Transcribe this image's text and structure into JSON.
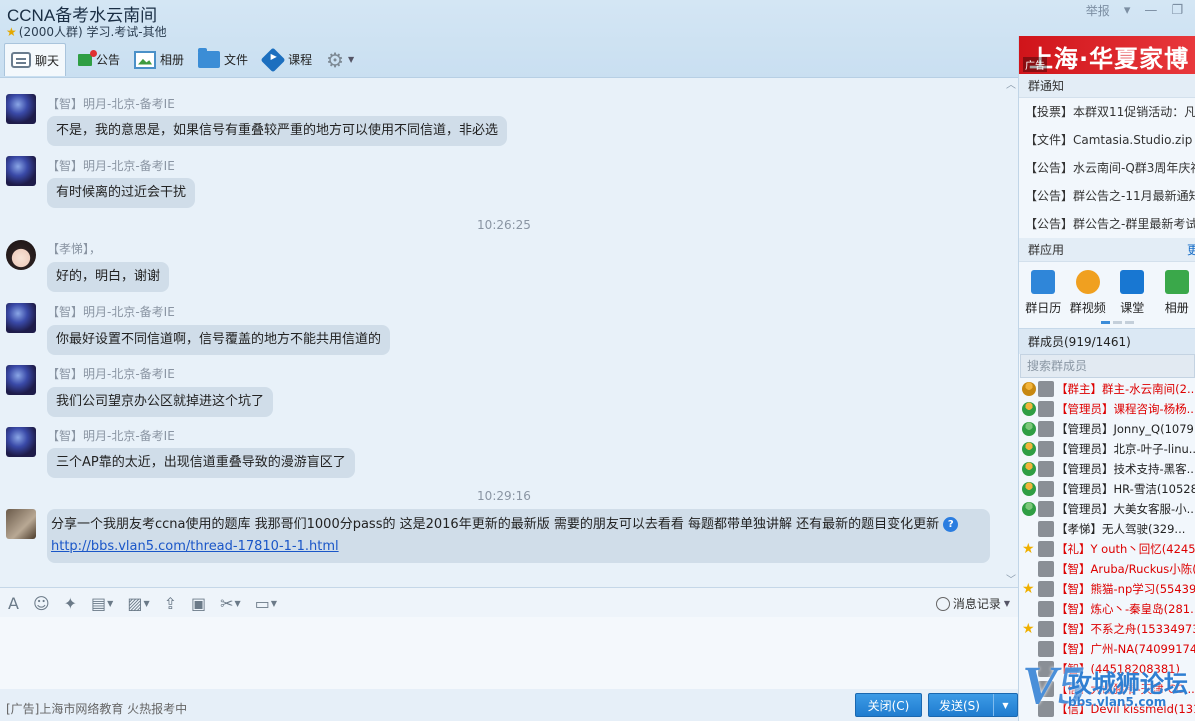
{
  "header": {
    "title": "CCNA备考水云南间",
    "subtitle": "(2000人群) 学习.考试-其他",
    "report": "举报"
  },
  "toolbar": {
    "items": [
      {
        "label": "聊天",
        "icon": "chat-icon"
      },
      {
        "label": "公告",
        "icon": "notice-icon"
      },
      {
        "label": "相册",
        "icon": "album-icon"
      },
      {
        "label": "文件",
        "icon": "folder-icon"
      },
      {
        "label": "课程",
        "icon": "course-icon"
      }
    ]
  },
  "chat": {
    "messages": [
      {
        "sender": "【智】明月-北京-备考IE",
        "text": "不是，我的意思是，如果信号有重叠较严重的地方可以使用不同信道，非必选"
      },
      {
        "sender": "【智】明月-北京-备考IE",
        "text": "有时候离的过近会干扰"
      },
      {
        "time": "10:26:25"
      },
      {
        "sender": "【孝悌】，",
        "text": "好的，明白，谢谢"
      },
      {
        "sender": "【智】明月-北京-备考IE",
        "text": "你最好设置不同信道啊，信号覆盖的地方不能共用信道的"
      },
      {
        "sender": "【智】明月-北京-备考IE",
        "text": "我们公司望京办公区就掉进这个坑了"
      },
      {
        "sender": "【智】明月-北京-备考IE",
        "text": "三个AP靠的太近，出现信道重叠导致的漫游盲区了"
      },
      {
        "time": "10:29:16"
      },
      {
        "text": "分享一个我朋友考ccna使用的题库 我那哥们1000分pass的 这是2016年更新的最新版 需要的朋友可以去看看 每题都带单独讲解 还有最新的题目变化更新",
        "link": "http://bbs.vlan5.com/thread-17810-1-1.html"
      }
    ]
  },
  "input": {
    "history_label": "消息记录"
  },
  "footer": {
    "ad_text": "[广告]上海市网络教育 火热报考中",
    "close_label": "关闭(C)",
    "send_label": "发送(S)"
  },
  "right": {
    "ad_banner": "上海·华夏家博",
    "ad_tag": "广告",
    "notice_title": "群通知",
    "notices": [
      "【投票】本群双11促销活动：凡是",
      "【文件】Camtasia.Studio.zip",
      "【公告】水云南间-Q群3周年庆福",
      "【公告】群公告之-11月最新通知",
      "【公告】群公告之-群里最新考试"
    ],
    "apps_title": "群应用",
    "apps_more": "更",
    "apps": [
      {
        "label": "群日历",
        "icon": "calendar-icon"
      },
      {
        "label": "群视频",
        "icon": "video-icon"
      },
      {
        "label": "课堂",
        "icon": "classroom-icon"
      },
      {
        "label": "相册",
        "icon": "album-icon"
      }
    ],
    "members_title": "群成员(919/1461)",
    "search_placeholder": "搜索群成员",
    "members": [
      {
        "name": "【群主】群主-水云南间(2...",
        "role": "owner"
      },
      {
        "name": "【管理员】课程咨询-杨杨...",
        "role": "admin"
      },
      {
        "name": "【管理员】Jonny_Q(1079...",
        "role": "mod"
      },
      {
        "name": "【管理员】北京-叶子-linu...",
        "role": "admin"
      },
      {
        "name": "【管理员】技术支持-黑客...",
        "role": "admin"
      },
      {
        "name": "【管理员】HR-雪洁(10528...",
        "role": "admin"
      },
      {
        "name": "【管理员】大美女客服-小...",
        "role": "mod"
      },
      {
        "name": "【孝悌】无人驾驶(329...",
        "role": "none"
      },
      {
        "name": "【礼】Y outh丶回忆(4245...",
        "role": "star"
      },
      {
        "name": "【智】Aruba/Ruckus小陈(...",
        "role": "none"
      },
      {
        "name": "【智】熊猫-np学习(55439...",
        "role": "star"
      },
      {
        "name": "【智】炼心丶-秦皇岛(281...",
        "role": "none"
      },
      {
        "name": "【智】不系之舟(15334973...",
        "role": "star"
      },
      {
        "name": "【智】广州-NA(740991746)",
        "role": "none"
      },
      {
        "name": "【智】(44518208381)",
        "role": "none"
      },
      {
        "name": "【信】大山猪爷-天津-CC...",
        "role": "none"
      },
      {
        "name": "【信】Devil kissmeld(13154",
        "role": "none"
      }
    ]
  },
  "watermark": {
    "brand": "V5",
    "text": "攻城狮论坛",
    "url": "bbs.vlan5.com"
  }
}
